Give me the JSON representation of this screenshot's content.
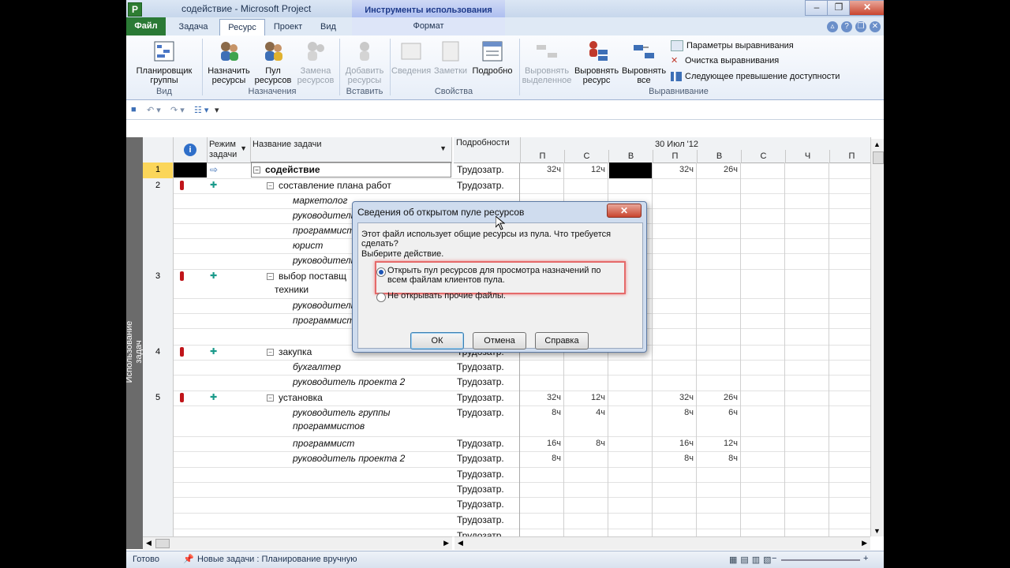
{
  "titlebar": {
    "app_letter": "P",
    "title": "содействие  -  Microsoft Project",
    "context_title": "Инструменты использования задач"
  },
  "tabs": {
    "file": "Файл",
    "task": "Задача",
    "resource": "Ресурс",
    "project": "Проект",
    "view": "Вид",
    "format": "Формат"
  },
  "ribbon": {
    "team_planner": "Планировщик\nгруппы",
    "assign": "Назначить\nресурсы",
    "pool": "Пул\nресурсов",
    "replace": "Замена\nресурсов",
    "add": "Добавить\nресурсы",
    "info": "Сведения",
    "notes": "Заметки",
    "details": "Подробно",
    "level_sel": "Выровнять\nвыделенное",
    "level_res": "Выровнять\nресурс",
    "level_all": "Выровнять\nвсе",
    "opt1": "Параметры выравнивания",
    "opt2": "Очистка выравнивания",
    "opt3": "Следующее превышение доступности",
    "groups": {
      "view": "Вид",
      "assignments": "Назначения",
      "insert": "Вставить",
      "properties": "Свойства",
      "leveling": "Выравнивание"
    }
  },
  "sheet": {
    "headers": {
      "mode": "Режим\nзадачи",
      "name": "Название задачи",
      "details": "Подробности"
    },
    "timescale": {
      "week": "30 Июл '12",
      "days": [
        "П",
        "С",
        "В",
        "П",
        "В",
        "С",
        "Ч",
        "П"
      ]
    },
    "sidebar_label": "Использование задач",
    "rows": [
      {
        "num": "1",
        "name": "содействие",
        "detail": "Трудозатр.",
        "v": [
          "32ч",
          "12ч",
          "",
          "32ч",
          "26ч",
          "",
          "",
          ""
        ]
      },
      {
        "num": "2",
        "name": "составление плана работ",
        "detail": "Трудозатр.",
        "v": [
          "",
          "",
          "",
          "",
          "",
          "",
          "",
          ""
        ]
      },
      {
        "num": "",
        "name": "маркетолог",
        "detail": "",
        "v": [
          "",
          "",
          "",
          "",
          "",
          "",
          "",
          ""
        ]
      },
      {
        "num": "",
        "name": "руководитель",
        "detail": "",
        "v": [
          "",
          "",
          "",
          "",
          "",
          "",
          "",
          ""
        ]
      },
      {
        "num": "",
        "name": "программист",
        "detail": "",
        "v": [
          "",
          "",
          "",
          "",
          "",
          "",
          "",
          ""
        ]
      },
      {
        "num": "",
        "name": "юрист",
        "detail": "",
        "v": [
          "",
          "",
          "",
          "",
          "",
          "",
          "",
          ""
        ]
      },
      {
        "num": "",
        "name": "руководитель",
        "detail": "",
        "v": [
          "",
          "",
          "",
          "",
          "",
          "",
          "",
          ""
        ]
      },
      {
        "num": "3",
        "name": "выбор поставщ",
        "name2": "техники",
        "detail": "",
        "v": [
          "",
          "",
          "",
          "",
          "",
          "",
          "",
          ""
        ]
      },
      {
        "num": "",
        "name": "руководитель",
        "detail": "",
        "v": [
          "",
          "",
          "",
          "",
          "",
          "",
          "",
          ""
        ]
      },
      {
        "num": "",
        "name": "программист",
        "detail": "",
        "v": [
          "",
          "",
          "",
          "",
          "",
          "",
          "",
          ""
        ]
      },
      {
        "num": "",
        "name": "",
        "detail": "",
        "v": [
          "",
          "",
          "",
          "",
          "",
          "",
          "",
          ""
        ]
      },
      {
        "num": "4",
        "name": "закупка",
        "detail": "Трудозатр.",
        "v": [
          "",
          "",
          "",
          "",
          "",
          "",
          "",
          ""
        ]
      },
      {
        "num": "",
        "name": "бухгалтер",
        "detail": "Трудозатр.",
        "v": [
          "",
          "",
          "",
          "",
          "",
          "",
          "",
          ""
        ]
      },
      {
        "num": "",
        "name": "руководитель проекта 2",
        "detail": "Трудозатр.",
        "v": [
          "",
          "",
          "",
          "",
          "",
          "",
          "",
          ""
        ]
      },
      {
        "num": "5",
        "name": "установка",
        "detail": "Трудозатр.",
        "v": [
          "32ч",
          "12ч",
          "",
          "32ч",
          "26ч",
          "",
          "",
          ""
        ]
      },
      {
        "num": "",
        "name": "руководитель группы",
        "name2": "программистов",
        "detail": "Трудозатр.",
        "v": [
          "8ч",
          "4ч",
          "",
          "8ч",
          "6ч",
          "",
          "",
          ""
        ]
      },
      {
        "num": "",
        "name": "программист",
        "detail": "Трудозатр.",
        "v": [
          "16ч",
          "8ч",
          "",
          "16ч",
          "12ч",
          "",
          "",
          ""
        ]
      },
      {
        "num": "",
        "name": "руководитель проекта 2",
        "detail": "Трудозатр.",
        "v": [
          "8ч",
          "",
          "",
          "8ч",
          "8ч",
          "",
          "",
          ""
        ]
      },
      {
        "num": "",
        "name": "",
        "detail": "Трудозатр.",
        "v": [
          "",
          "",
          "",
          "",
          "",
          "",
          "",
          ""
        ]
      },
      {
        "num": "",
        "name": "",
        "detail": "Трудозатр.",
        "v": [
          "",
          "",
          "",
          "",
          "",
          "",
          "",
          ""
        ]
      },
      {
        "num": "",
        "name": "",
        "detail": "Трудозатр.",
        "v": [
          "",
          "",
          "",
          "",
          "",
          "",
          "",
          ""
        ]
      },
      {
        "num": "",
        "name": "",
        "detail": "Трудозатр.",
        "v": [
          "",
          "",
          "",
          "",
          "",
          "",
          "",
          ""
        ]
      },
      {
        "num": "",
        "name": "",
        "detail": "Трудозатр.",
        "v": [
          "",
          "",
          "",
          "",
          "",
          "",
          "",
          ""
        ]
      }
    ]
  },
  "dialog": {
    "title": "Сведения об открытом пуле ресурсов",
    "question": "Этот файл использует общие ресурсы из пула.  Что требуется сделать?",
    "choose": "Выберите действие.",
    "option1": "Открыть пул ресурсов для просмотра назначений по всем файлам клиентов пула.",
    "option2": "Не открывать прочие файлы.",
    "ok": "ОК",
    "cancel": "Отмена",
    "help": "Справка"
  },
  "status": {
    "ready": "Готово",
    "new_tasks": "Новые задачи : Планирование вручную"
  },
  "colors": {
    "file_tab": "#2b7a35",
    "highlight": "#e56a6a",
    "selected_row": "#fbd65a"
  }
}
